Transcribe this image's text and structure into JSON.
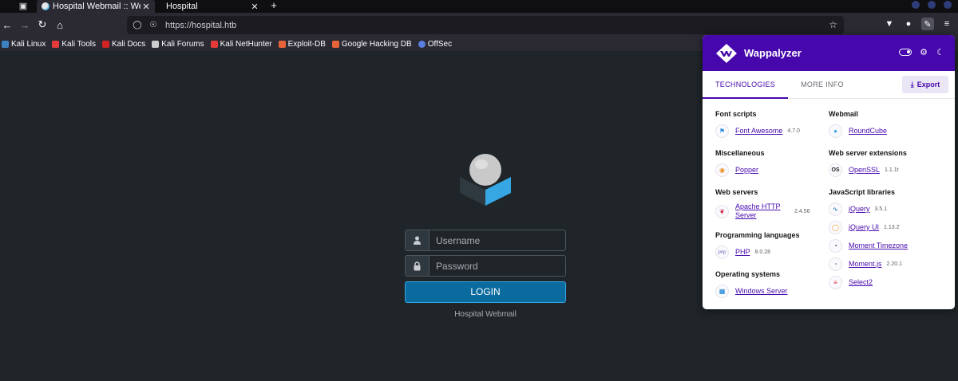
{
  "browser": {
    "tabs": [
      {
        "title": "Hospital Webmail :: Welc",
        "active": true
      },
      {
        "title": "Hospital",
        "active": false
      }
    ],
    "url": "https://hospital.htb",
    "bookmarks": [
      {
        "label": "Kali Linux",
        "icon": "kali-dragon-icon",
        "color": "#3a82c4"
      },
      {
        "label": "Kali Tools",
        "icon": "kali-tools-icon",
        "color": "#e53a3a"
      },
      {
        "label": "Kali Docs",
        "icon": "kali-docs-icon",
        "color": "#d02323"
      },
      {
        "label": "Kali Forums",
        "icon": "kali-forums-icon",
        "color": "#cccccc"
      },
      {
        "label": "Kali NetHunter",
        "icon": "nethunter-icon",
        "color": "#e53a3a"
      },
      {
        "label": "Exploit-DB",
        "icon": "exploit-db-icon",
        "color": "#e7643b"
      },
      {
        "label": "Google Hacking DB",
        "icon": "ghdb-icon",
        "color": "#e7643b"
      },
      {
        "label": "OffSec",
        "icon": "offsec-icon",
        "color": "#5a7fe0"
      }
    ]
  },
  "login": {
    "username_placeholder": "Username",
    "password_placeholder": "Password",
    "button_label": "LOGIN",
    "footer": "Hospital Webmail"
  },
  "wappalyzer": {
    "title": "Wappalyzer",
    "tabs": {
      "technologies": "TECHNOLOGIES",
      "more_info": "MORE INFO"
    },
    "export_label": "Export",
    "left_column": [
      {
        "category": "Font scripts",
        "items": [
          {
            "name": "Font Awesome",
            "version": "4.7.0",
            "icon": "flag-icon"
          }
        ]
      },
      {
        "category": "Miscellaneous",
        "items": [
          {
            "name": "Popper",
            "version": "",
            "icon": "popper-icon"
          }
        ]
      },
      {
        "category": "Web servers",
        "items": [
          {
            "name": "Apache HTTP Server",
            "version": "2.4.56",
            "icon": "apache-feather-icon"
          }
        ]
      },
      {
        "category": "Programming languages",
        "items": [
          {
            "name": "PHP",
            "version": "8.0.28",
            "icon": "php-icon"
          }
        ]
      },
      {
        "category": "Operating systems",
        "items": [
          {
            "name": "Windows Server",
            "version": "",
            "icon": "windows-icon"
          }
        ]
      }
    ],
    "right_column": [
      {
        "category": "Webmail",
        "items": [
          {
            "name": "RoundCube",
            "version": "",
            "icon": "roundcube-icon"
          }
        ]
      },
      {
        "category": "Web server extensions",
        "items": [
          {
            "name": "OpenSSL",
            "version": "1.1.1t",
            "icon": "openssl-icon"
          }
        ]
      },
      {
        "category": "JavaScript libraries",
        "items": [
          {
            "name": "jQuery",
            "version": "3.5.1",
            "icon": "jquery-icon"
          },
          {
            "name": "jQuery UI",
            "version": "1.13.2",
            "icon": "jquery-ui-icon"
          },
          {
            "name": "Moment Timezone",
            "version": "",
            "icon": "moment-timezone-icon"
          },
          {
            "name": "Moment.js",
            "version": "2.20.1",
            "icon": "momentjs-icon"
          },
          {
            "name": "Select2",
            "version": "",
            "icon": "select2-icon"
          }
        ]
      }
    ]
  }
}
